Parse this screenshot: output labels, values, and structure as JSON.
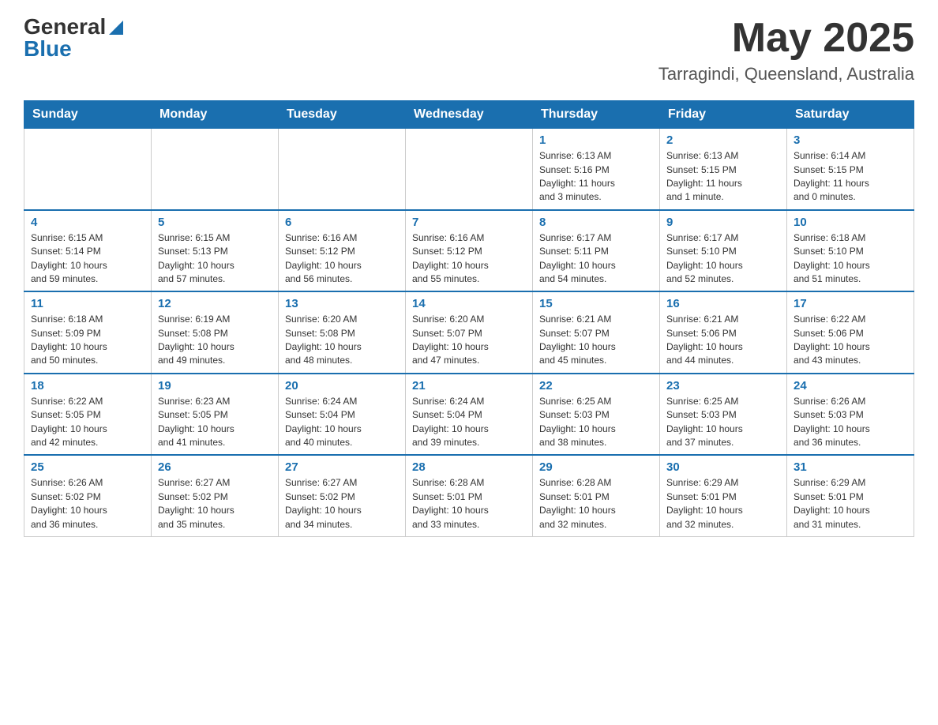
{
  "header": {
    "logo_general": "General",
    "logo_blue": "Blue",
    "month_year": "May 2025",
    "location": "Tarragindi, Queensland, Australia"
  },
  "days_of_week": [
    "Sunday",
    "Monday",
    "Tuesday",
    "Wednesday",
    "Thursday",
    "Friday",
    "Saturday"
  ],
  "weeks": [
    [
      {
        "day": "",
        "info": ""
      },
      {
        "day": "",
        "info": ""
      },
      {
        "day": "",
        "info": ""
      },
      {
        "day": "",
        "info": ""
      },
      {
        "day": "1",
        "info": "Sunrise: 6:13 AM\nSunset: 5:16 PM\nDaylight: 11 hours\nand 3 minutes."
      },
      {
        "day": "2",
        "info": "Sunrise: 6:13 AM\nSunset: 5:15 PM\nDaylight: 11 hours\nand 1 minute."
      },
      {
        "day": "3",
        "info": "Sunrise: 6:14 AM\nSunset: 5:15 PM\nDaylight: 11 hours\nand 0 minutes."
      }
    ],
    [
      {
        "day": "4",
        "info": "Sunrise: 6:15 AM\nSunset: 5:14 PM\nDaylight: 10 hours\nand 59 minutes."
      },
      {
        "day": "5",
        "info": "Sunrise: 6:15 AM\nSunset: 5:13 PM\nDaylight: 10 hours\nand 57 minutes."
      },
      {
        "day": "6",
        "info": "Sunrise: 6:16 AM\nSunset: 5:12 PM\nDaylight: 10 hours\nand 56 minutes."
      },
      {
        "day": "7",
        "info": "Sunrise: 6:16 AM\nSunset: 5:12 PM\nDaylight: 10 hours\nand 55 minutes."
      },
      {
        "day": "8",
        "info": "Sunrise: 6:17 AM\nSunset: 5:11 PM\nDaylight: 10 hours\nand 54 minutes."
      },
      {
        "day": "9",
        "info": "Sunrise: 6:17 AM\nSunset: 5:10 PM\nDaylight: 10 hours\nand 52 minutes."
      },
      {
        "day": "10",
        "info": "Sunrise: 6:18 AM\nSunset: 5:10 PM\nDaylight: 10 hours\nand 51 minutes."
      }
    ],
    [
      {
        "day": "11",
        "info": "Sunrise: 6:18 AM\nSunset: 5:09 PM\nDaylight: 10 hours\nand 50 minutes."
      },
      {
        "day": "12",
        "info": "Sunrise: 6:19 AM\nSunset: 5:08 PM\nDaylight: 10 hours\nand 49 minutes."
      },
      {
        "day": "13",
        "info": "Sunrise: 6:20 AM\nSunset: 5:08 PM\nDaylight: 10 hours\nand 48 minutes."
      },
      {
        "day": "14",
        "info": "Sunrise: 6:20 AM\nSunset: 5:07 PM\nDaylight: 10 hours\nand 47 minutes."
      },
      {
        "day": "15",
        "info": "Sunrise: 6:21 AM\nSunset: 5:07 PM\nDaylight: 10 hours\nand 45 minutes."
      },
      {
        "day": "16",
        "info": "Sunrise: 6:21 AM\nSunset: 5:06 PM\nDaylight: 10 hours\nand 44 minutes."
      },
      {
        "day": "17",
        "info": "Sunrise: 6:22 AM\nSunset: 5:06 PM\nDaylight: 10 hours\nand 43 minutes."
      }
    ],
    [
      {
        "day": "18",
        "info": "Sunrise: 6:22 AM\nSunset: 5:05 PM\nDaylight: 10 hours\nand 42 minutes."
      },
      {
        "day": "19",
        "info": "Sunrise: 6:23 AM\nSunset: 5:05 PM\nDaylight: 10 hours\nand 41 minutes."
      },
      {
        "day": "20",
        "info": "Sunrise: 6:24 AM\nSunset: 5:04 PM\nDaylight: 10 hours\nand 40 minutes."
      },
      {
        "day": "21",
        "info": "Sunrise: 6:24 AM\nSunset: 5:04 PM\nDaylight: 10 hours\nand 39 minutes."
      },
      {
        "day": "22",
        "info": "Sunrise: 6:25 AM\nSunset: 5:03 PM\nDaylight: 10 hours\nand 38 minutes."
      },
      {
        "day": "23",
        "info": "Sunrise: 6:25 AM\nSunset: 5:03 PM\nDaylight: 10 hours\nand 37 minutes."
      },
      {
        "day": "24",
        "info": "Sunrise: 6:26 AM\nSunset: 5:03 PM\nDaylight: 10 hours\nand 36 minutes."
      }
    ],
    [
      {
        "day": "25",
        "info": "Sunrise: 6:26 AM\nSunset: 5:02 PM\nDaylight: 10 hours\nand 36 minutes."
      },
      {
        "day": "26",
        "info": "Sunrise: 6:27 AM\nSunset: 5:02 PM\nDaylight: 10 hours\nand 35 minutes."
      },
      {
        "day": "27",
        "info": "Sunrise: 6:27 AM\nSunset: 5:02 PM\nDaylight: 10 hours\nand 34 minutes."
      },
      {
        "day": "28",
        "info": "Sunrise: 6:28 AM\nSunset: 5:01 PM\nDaylight: 10 hours\nand 33 minutes."
      },
      {
        "day": "29",
        "info": "Sunrise: 6:28 AM\nSunset: 5:01 PM\nDaylight: 10 hours\nand 32 minutes."
      },
      {
        "day": "30",
        "info": "Sunrise: 6:29 AM\nSunset: 5:01 PM\nDaylight: 10 hours\nand 32 minutes."
      },
      {
        "day": "31",
        "info": "Sunrise: 6:29 AM\nSunset: 5:01 PM\nDaylight: 10 hours\nand 31 minutes."
      }
    ]
  ]
}
